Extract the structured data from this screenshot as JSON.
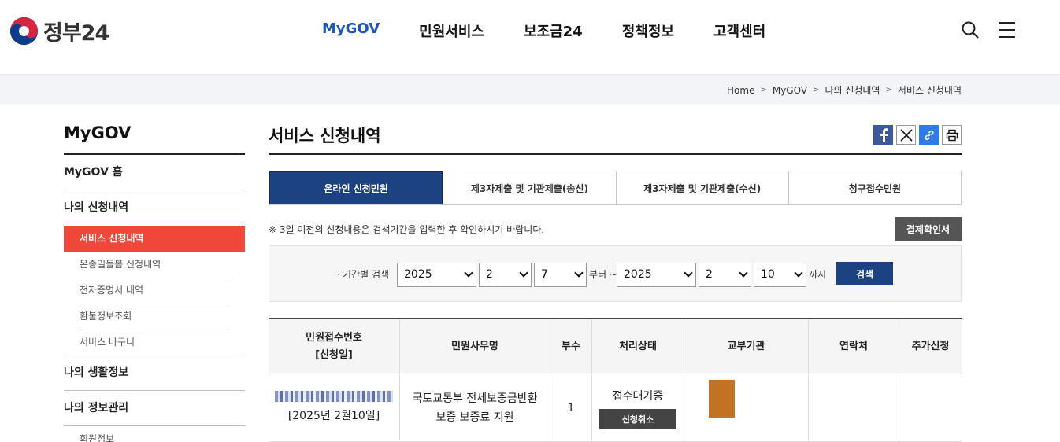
{
  "header": {
    "logo_text": "정부24",
    "nav": [
      "MyGOV",
      "민원서비스",
      "보조금24",
      "정책정보",
      "고객센터"
    ]
  },
  "breadcrumb": [
    "Home",
    "MyGOV",
    "나의 신청내역",
    "서비스 신청내역"
  ],
  "sidebar": {
    "title": "MyGOV",
    "home": "MyGOV 홈",
    "apply": "나의 신청내역",
    "sub": [
      "서비스 신청내역",
      "온종일돌봄 신청내역",
      "전자증명서 내역",
      "환불정보조회",
      "서비스 바구니"
    ],
    "life": "나의 생활정보",
    "info": "나의 정보관리",
    "info_sub": "회원정보"
  },
  "main": {
    "title": "서비스 신청내역",
    "tabs": [
      "온라인 신청민원",
      "제3자제출 및 기관제출(송신)",
      "제3자제출 및 기관제출(수신)",
      "청구접수민원"
    ],
    "notice": "※ 3일 이전의 신청내용은 검색기간을 입력한 후 확인하시기 바랍니다.",
    "receipt_btn": "결제확인서",
    "search": {
      "label": "ㆍ기간별 검색",
      "from_year": "2025",
      "from_month": "2",
      "from_day": "7",
      "from_text": "부터 ~",
      "to_year": "2025",
      "to_month": "2",
      "to_day": "10",
      "to_text": "까지",
      "button": "검색"
    },
    "table": {
      "headers": {
        "no_line1": "민원접수번호",
        "no_line2": "[신청일]",
        "name": "민원사무명",
        "count": "부수",
        "status": "처리상태",
        "org": "교부기관",
        "contact": "연락처",
        "extra": "추가신청"
      },
      "row": {
        "date": "[2025년 2월10일]",
        "name_line1": "국토교통부 전세보증금반환",
        "name_line2": "보증 보증료 지원",
        "count": "1",
        "status": "접수대기중",
        "cancel": "신청취소"
      }
    }
  }
}
